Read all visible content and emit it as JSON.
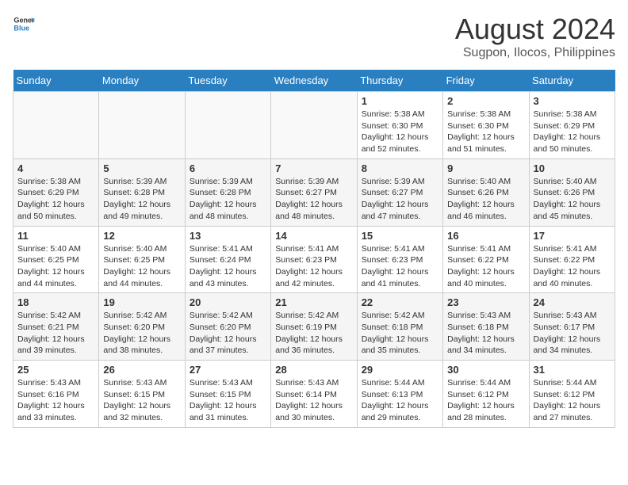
{
  "header": {
    "logo_general": "General",
    "logo_blue": "Blue",
    "month_year": "August 2024",
    "location": "Sugpon, Ilocos, Philippines"
  },
  "days_of_week": [
    "Sunday",
    "Monday",
    "Tuesday",
    "Wednesday",
    "Thursday",
    "Friday",
    "Saturday"
  ],
  "weeks": [
    [
      {
        "day": "",
        "info": ""
      },
      {
        "day": "",
        "info": ""
      },
      {
        "day": "",
        "info": ""
      },
      {
        "day": "",
        "info": ""
      },
      {
        "day": "1",
        "info": "Sunrise: 5:38 AM\nSunset: 6:30 PM\nDaylight: 12 hours\nand 52 minutes."
      },
      {
        "day": "2",
        "info": "Sunrise: 5:38 AM\nSunset: 6:30 PM\nDaylight: 12 hours\nand 51 minutes."
      },
      {
        "day": "3",
        "info": "Sunrise: 5:38 AM\nSunset: 6:29 PM\nDaylight: 12 hours\nand 50 minutes."
      }
    ],
    [
      {
        "day": "4",
        "info": "Sunrise: 5:38 AM\nSunset: 6:29 PM\nDaylight: 12 hours\nand 50 minutes."
      },
      {
        "day": "5",
        "info": "Sunrise: 5:39 AM\nSunset: 6:28 PM\nDaylight: 12 hours\nand 49 minutes."
      },
      {
        "day": "6",
        "info": "Sunrise: 5:39 AM\nSunset: 6:28 PM\nDaylight: 12 hours\nand 48 minutes."
      },
      {
        "day": "7",
        "info": "Sunrise: 5:39 AM\nSunset: 6:27 PM\nDaylight: 12 hours\nand 48 minutes."
      },
      {
        "day": "8",
        "info": "Sunrise: 5:39 AM\nSunset: 6:27 PM\nDaylight: 12 hours\nand 47 minutes."
      },
      {
        "day": "9",
        "info": "Sunrise: 5:40 AM\nSunset: 6:26 PM\nDaylight: 12 hours\nand 46 minutes."
      },
      {
        "day": "10",
        "info": "Sunrise: 5:40 AM\nSunset: 6:26 PM\nDaylight: 12 hours\nand 45 minutes."
      }
    ],
    [
      {
        "day": "11",
        "info": "Sunrise: 5:40 AM\nSunset: 6:25 PM\nDaylight: 12 hours\nand 44 minutes."
      },
      {
        "day": "12",
        "info": "Sunrise: 5:40 AM\nSunset: 6:25 PM\nDaylight: 12 hours\nand 44 minutes."
      },
      {
        "day": "13",
        "info": "Sunrise: 5:41 AM\nSunset: 6:24 PM\nDaylight: 12 hours\nand 43 minutes."
      },
      {
        "day": "14",
        "info": "Sunrise: 5:41 AM\nSunset: 6:23 PM\nDaylight: 12 hours\nand 42 minutes."
      },
      {
        "day": "15",
        "info": "Sunrise: 5:41 AM\nSunset: 6:23 PM\nDaylight: 12 hours\nand 41 minutes."
      },
      {
        "day": "16",
        "info": "Sunrise: 5:41 AM\nSunset: 6:22 PM\nDaylight: 12 hours\nand 40 minutes."
      },
      {
        "day": "17",
        "info": "Sunrise: 5:41 AM\nSunset: 6:22 PM\nDaylight: 12 hours\nand 40 minutes."
      }
    ],
    [
      {
        "day": "18",
        "info": "Sunrise: 5:42 AM\nSunset: 6:21 PM\nDaylight: 12 hours\nand 39 minutes."
      },
      {
        "day": "19",
        "info": "Sunrise: 5:42 AM\nSunset: 6:20 PM\nDaylight: 12 hours\nand 38 minutes."
      },
      {
        "day": "20",
        "info": "Sunrise: 5:42 AM\nSunset: 6:20 PM\nDaylight: 12 hours\nand 37 minutes."
      },
      {
        "day": "21",
        "info": "Sunrise: 5:42 AM\nSunset: 6:19 PM\nDaylight: 12 hours\nand 36 minutes."
      },
      {
        "day": "22",
        "info": "Sunrise: 5:42 AM\nSunset: 6:18 PM\nDaylight: 12 hours\nand 35 minutes."
      },
      {
        "day": "23",
        "info": "Sunrise: 5:43 AM\nSunset: 6:18 PM\nDaylight: 12 hours\nand 34 minutes."
      },
      {
        "day": "24",
        "info": "Sunrise: 5:43 AM\nSunset: 6:17 PM\nDaylight: 12 hours\nand 34 minutes."
      }
    ],
    [
      {
        "day": "25",
        "info": "Sunrise: 5:43 AM\nSunset: 6:16 PM\nDaylight: 12 hours\nand 33 minutes."
      },
      {
        "day": "26",
        "info": "Sunrise: 5:43 AM\nSunset: 6:15 PM\nDaylight: 12 hours\nand 32 minutes."
      },
      {
        "day": "27",
        "info": "Sunrise: 5:43 AM\nSunset: 6:15 PM\nDaylight: 12 hours\nand 31 minutes."
      },
      {
        "day": "28",
        "info": "Sunrise: 5:43 AM\nSunset: 6:14 PM\nDaylight: 12 hours\nand 30 minutes."
      },
      {
        "day": "29",
        "info": "Sunrise: 5:44 AM\nSunset: 6:13 PM\nDaylight: 12 hours\nand 29 minutes."
      },
      {
        "day": "30",
        "info": "Sunrise: 5:44 AM\nSunset: 6:12 PM\nDaylight: 12 hours\nand 28 minutes."
      },
      {
        "day": "31",
        "info": "Sunrise: 5:44 AM\nSunset: 6:12 PM\nDaylight: 12 hours\nand 27 minutes."
      }
    ]
  ]
}
